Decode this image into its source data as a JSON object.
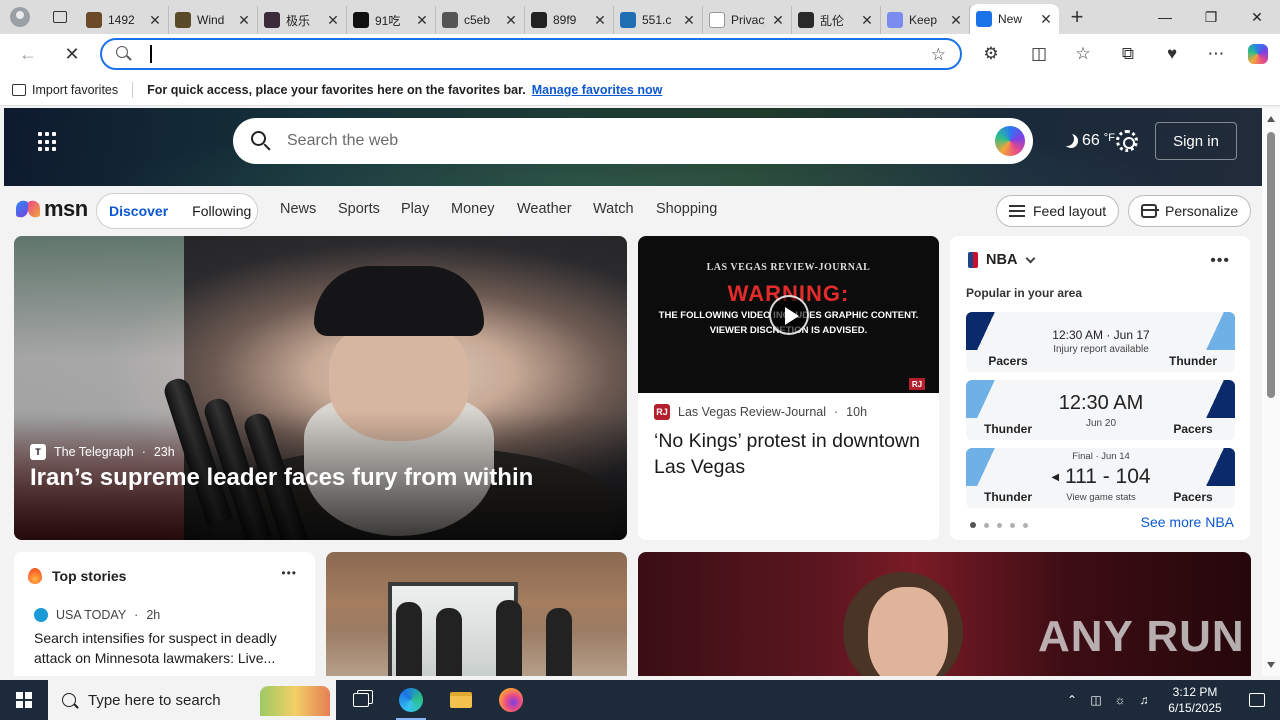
{
  "browser": {
    "tabs": [
      {
        "title": "1492",
        "favicon_color": "#6b4a2a",
        "active": false
      },
      {
        "title": "Wind",
        "favicon_color": "#5a4a2a",
        "active": false
      },
      {
        "title": "极乐",
        "favicon_color": "#3a2a3a",
        "active": false
      },
      {
        "title": "91吃",
        "favicon_color": "#111111",
        "active": false
      },
      {
        "title": "c5eb",
        "favicon_color": "#555555",
        "active": false
      },
      {
        "title": "89f9",
        "favicon_color": "#222222",
        "active": false
      },
      {
        "title": "551.c",
        "favicon_color": "#1f6fb2",
        "active": false
      },
      {
        "title": "Privacy err",
        "favicon_color": "#ffffff",
        "active": false
      },
      {
        "title": "乱伦",
        "favicon_color": "#2a2a2a",
        "active": false
      },
      {
        "title": "Keep",
        "favicon_color": "#7b8cf0",
        "active": false
      },
      {
        "title": "New",
        "favicon_color": "#1a73e8",
        "active": true
      }
    ],
    "address_value": "",
    "favorites_bar": {
      "import_label": "Import favorites",
      "message": "For quick access, place your favorites here on the favorites bar.",
      "manage_link": "Manage favorites now"
    }
  },
  "msn": {
    "search_placeholder": "Search the web",
    "weather": "66",
    "weather_unit": "°F",
    "signin_label": "Sign in",
    "logo_text": "msn",
    "pills": [
      "Discover",
      "Following"
    ],
    "nav_links": [
      "News",
      "Sports",
      "Play",
      "Money",
      "Weather",
      "Watch",
      "Shopping"
    ],
    "feed_layout_label": "Feed layout",
    "personalize_label": "Personalize",
    "hero": {
      "source": "The Telegraph",
      "age": "23h",
      "title": "Iran’s supreme leader faces fury from within"
    },
    "video": {
      "thumb_brand": "LAS VEGAS REVIEW-JOURNAL",
      "thumb_warning": "WARNING:",
      "thumb_line1": "THE FOLLOWING VIDEO INCLUDES GRAPHIC CONTENT.",
      "thumb_line2": "VIEWER DISCRETION IS ADVISED.",
      "corner_badge": "RJ",
      "source": "Las Vegas Review-Journal",
      "source_badge": "RJ",
      "age": "10h",
      "title": "‘No Kings’ protest in downtown Las Vegas"
    },
    "nba": {
      "league": "NBA",
      "subtitle": "Popular in your area",
      "games": [
        {
          "left": "Pacers",
          "right": "Thunder",
          "main": "12:30 AM · Jun 17",
          "sub": "Injury report available"
        },
        {
          "left": "Thunder",
          "right": "Pacers",
          "main": "12:30 AM",
          "sub": "Jun 20"
        },
        {
          "left": "Thunder",
          "right": "Pacers",
          "top": "Final · Jun 14",
          "main": "111 - 104",
          "sub": "View game stats"
        }
      ],
      "see_more": "See more NBA"
    },
    "top_stories": {
      "heading": "Top stories",
      "source": "USA TODAY",
      "age": "2h",
      "title": "Search intensifies for suspect in deadly attack on Minnesota lawmakers: Live..."
    },
    "watermark": "ANY RUN"
  },
  "taskbar": {
    "search_placeholder": "Type here to search",
    "time": "3:12 PM",
    "date": "6/15/2025"
  }
}
